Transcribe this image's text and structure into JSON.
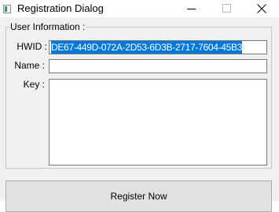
{
  "window": {
    "title": "Registration Dialog",
    "icon": "app-icon"
  },
  "group": {
    "legend": "User Information :"
  },
  "fields": {
    "hwid_label": "HWID :",
    "hwid_value": "DE67-449D-072A-2D53-6D3B-2717-7604-45B3",
    "name_label": "Name :",
    "name_value": "",
    "key_label": "Key :",
    "key_value": ""
  },
  "actions": {
    "register_label": "Register Now"
  },
  "colors": {
    "selection": "#0078d7",
    "dialog_bg": "#f0f0f0",
    "button_bg": "#e1e1e1"
  }
}
